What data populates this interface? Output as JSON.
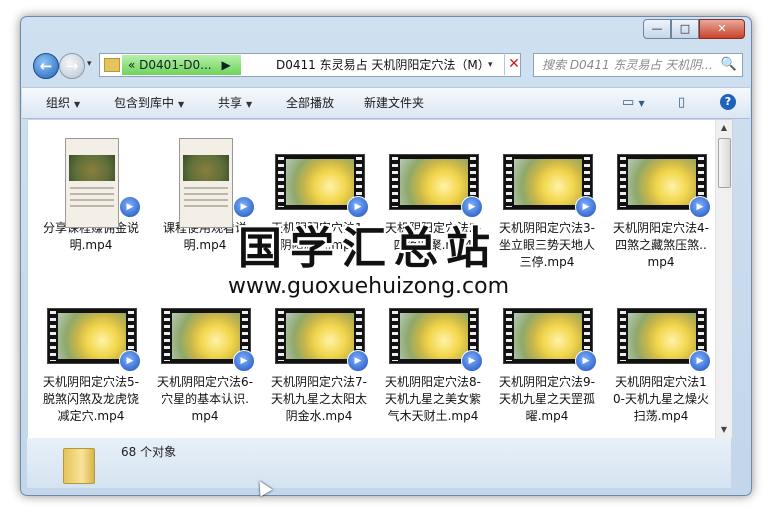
{
  "window": {
    "caption_buttons": {
      "minimize": "—",
      "maximize": "□",
      "close": "✕"
    }
  },
  "nav": {
    "breadcrumb": {
      "prefix": "«",
      "folder": "D0401-D0...",
      "separator": "▶"
    },
    "current_folder": "D0411 东灵易占 天机阴阳定穴法（M）",
    "dropdown": "▾",
    "clear": "✕",
    "search_placeholder": "搜索 D0411 东灵易占 天机阴...",
    "search_icon": "🔍"
  },
  "toolbar": {
    "organize": "组织",
    "include_library": "包含到库中",
    "share": "共享",
    "play_all": "全部播放",
    "new_folder": "新建文件夹",
    "view_icon": "▭",
    "preview_icon": "▯",
    "help": "?"
  },
  "files": [
    {
      "name": "分享课程赚佣金说明.mp4",
      "thumb": "phone"
    },
    {
      "name": "课程使用观看说明.mp4",
      "thumb": "phone"
    },
    {
      "name": "天机阴阳定穴法1-阴阳总论.mp4",
      "thumb": "video"
    },
    {
      "name": "天机阴阳定穴法2-四落四聚.mp4",
      "thumb": "video"
    },
    {
      "name": "天机阴阳定穴法3-坐立眼三势天地人三停.mp4",
      "thumb": "video"
    },
    {
      "name": "天机阴阳定穴法4-四煞之藏煞压煞..mp4",
      "thumb": "video"
    },
    {
      "name": "天机阴阳定穴法5-脱煞闪煞及龙虎饶减定穴.mp4",
      "thumb": "video"
    },
    {
      "name": "天机阴阳定穴法6-穴星的基本认识.mp4",
      "thumb": "video"
    },
    {
      "name": "天机阴阳定穴法7-天机九星之太阳太阴金水.mp4",
      "thumb": "video"
    },
    {
      "name": "天机阴阳定穴法8-天机九星之美女紫气木天财土.mp4",
      "thumb": "video"
    },
    {
      "name": "天机阴阳定穴法9-天机九星之天罡孤曜.mp4",
      "thumb": "video"
    },
    {
      "name": "天机阴阳定穴法10-天机九星之燥火扫荡.mp4",
      "thumb": "video"
    }
  ],
  "status": {
    "count": "68 个对象"
  },
  "watermark": {
    "title": "国学汇总站",
    "url": "www.guoxuehuizong.com"
  }
}
